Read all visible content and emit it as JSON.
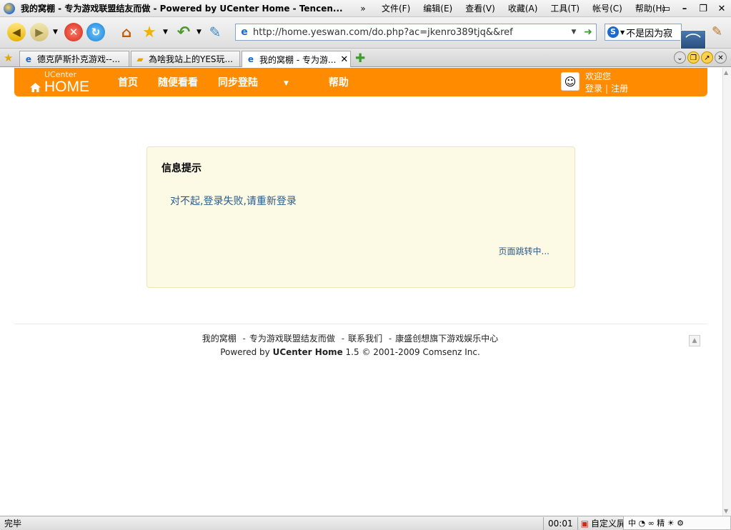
{
  "browser": {
    "window_title": "我的窝棚 - 专为游戏联盟结友而做 - Powered by UCenter Home - Tencen...",
    "more_chevron": "»",
    "menu": [
      "文件(F)",
      "编辑(E)",
      "查看(V)",
      "收藏(A)",
      "工具(T)",
      "帐号(C)",
      "帮助(H)"
    ],
    "window_buttons": [
      "▭",
      "–",
      "❐",
      "✕"
    ],
    "address_url": "http://home.yeswan.com/do.php?ac=jkenro389tjq&&ref",
    "search_value": "不是因为寂",
    "tabs": [
      {
        "label": "德克萨斯扑克游戏--...",
        "icon": "ie-icon",
        "active": false
      },
      {
        "label": "為啥我站上的YES玩...",
        "icon": "chat-icon",
        "active": false
      },
      {
        "label": "我的窝棚 - 专为游...",
        "icon": "ie-icon",
        "active": true
      }
    ],
    "status_text": "完毕",
    "status_time": "00:01",
    "status_zoom": "自定义屏幕",
    "ime_text": "中  ◔   ∞ 精 ☀ ⚙"
  },
  "site": {
    "logo_top": "UCenter",
    "logo_main": "HOME",
    "nav": [
      "首页",
      "随便看看",
      "同步登陆",
      "帮助"
    ],
    "welcome": "欢迎您",
    "login": "登录",
    "register": "注册",
    "separator": "|"
  },
  "message": {
    "title": "信息提示",
    "text": "对不起,登录失败,请重新登录",
    "redirect": "页面跳转中..."
  },
  "footer": {
    "links": [
      "我的窝棚",
      "专为游戏联盟结友而做",
      "联系我们",
      "康盛创想旗下游戏娱乐中心"
    ],
    "sep": "-",
    "powered_prefix": "Powered by",
    "powered_brand": "UCenter Home",
    "powered_suffix": "1.5 © 2001-2009 Comsenz Inc."
  },
  "colors": {
    "header_orange": "#ff8c00",
    "message_bg": "#fcf9e5",
    "link_blue": "#2a5c8a"
  }
}
